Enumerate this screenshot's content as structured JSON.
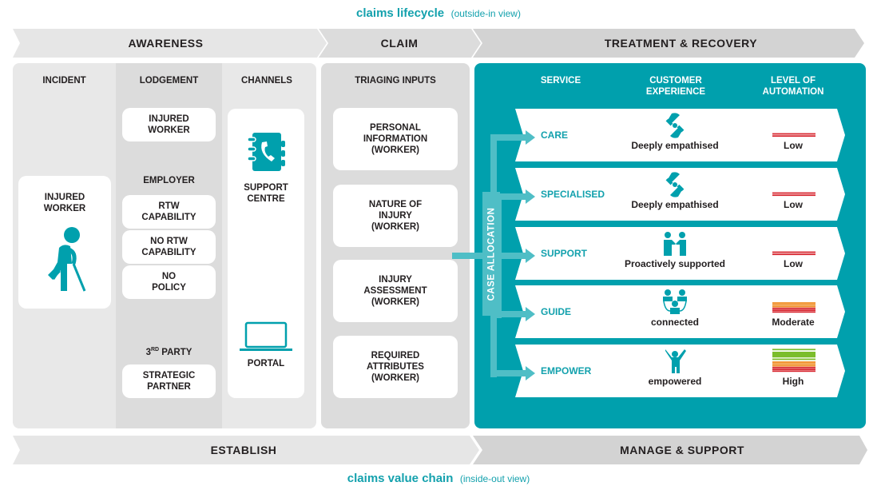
{
  "top_caption": {
    "title": "claims lifecycle",
    "subtitle": "(outside-in view)"
  },
  "bottom_caption": {
    "title": "claims value chain",
    "subtitle": "(inside-out view)"
  },
  "lifecycle_stages": [
    "AWARENESS",
    "CLAIM",
    "TREATMENT & RECOVERY"
  ],
  "value_chain_stages": [
    "ESTABLISH",
    "MANAGE & SUPPORT"
  ],
  "awareness": {
    "incident": {
      "header": "INCIDENT",
      "card": "INJURED\nWORKER",
      "icon": "injured-worker-icon"
    },
    "lodgement": {
      "header": "LODGEMENT",
      "top_card": "INJURED\nWORKER",
      "employer_label": "EMPLOYER",
      "employer_cards": [
        "RTW\nCAPABILITY",
        "NO RTW\nCAPABILITY",
        "NO\nPOLICY"
      ],
      "third_party_label": "3",
      "third_party_sup": "RD",
      "third_party_rest": " PARTY",
      "third_party_card": "STRATEGIC\nPARTNER"
    },
    "channels": {
      "header": "CHANNELS",
      "items": [
        {
          "label": "SUPPORT\nCENTRE",
          "icon": "phone-book-icon"
        },
        {
          "label": "PORTAL",
          "icon": "laptop-icon"
        }
      ]
    }
  },
  "claim": {
    "header": "TRIAGING INPUTS",
    "cards": [
      "PERSONAL\nINFORMATION\n(WORKER)",
      "NATURE OF\nINJURY\n(WORKER)",
      "INJURY\nASSESSMENT\n(WORKER)",
      "REQUIRED\nATTRIBUTES\n(WORKER)"
    ]
  },
  "treatment": {
    "headers": {
      "service": "SERVICE",
      "experience": "CUSTOMER\nEXPERIENCE",
      "automation": "LEVEL OF\nAUTOMATION"
    },
    "case_allocation_label": "CASE ALLOCATION",
    "rows": [
      {
        "service": "CARE",
        "experience": "Deeply empathised",
        "experience_icon": "caring-hands-icon",
        "automation": "Low",
        "automation_level": 1
      },
      {
        "service": "SPECIALISED",
        "experience": "Deeply empathised",
        "experience_icon": "caring-hands-icon",
        "automation": "Low",
        "automation_level": 1
      },
      {
        "service": "SUPPORT",
        "experience": "Proactively supported",
        "experience_icon": "handshake-people-icon",
        "automation": "Low",
        "automation_level": 1
      },
      {
        "service": "GUIDE",
        "experience": "connected",
        "experience_icon": "connected-people-icon",
        "automation": "Moderate",
        "automation_level": 2
      },
      {
        "service": "EMPOWER",
        "experience": "empowered",
        "experience_icon": "celebrating-person-icon",
        "automation": "High",
        "automation_level": 3
      }
    ]
  },
  "colors": {
    "teal": "#00a0ad",
    "teal_light": "#4fbec6",
    "text_teal": "#13a1ad",
    "level_low": "#d7262f",
    "level_moderate": "#ef8b1e",
    "level_high": "#7bbd2b",
    "panel_light": "#e8e8e8",
    "panel_mid": "#dcdcdc"
  }
}
